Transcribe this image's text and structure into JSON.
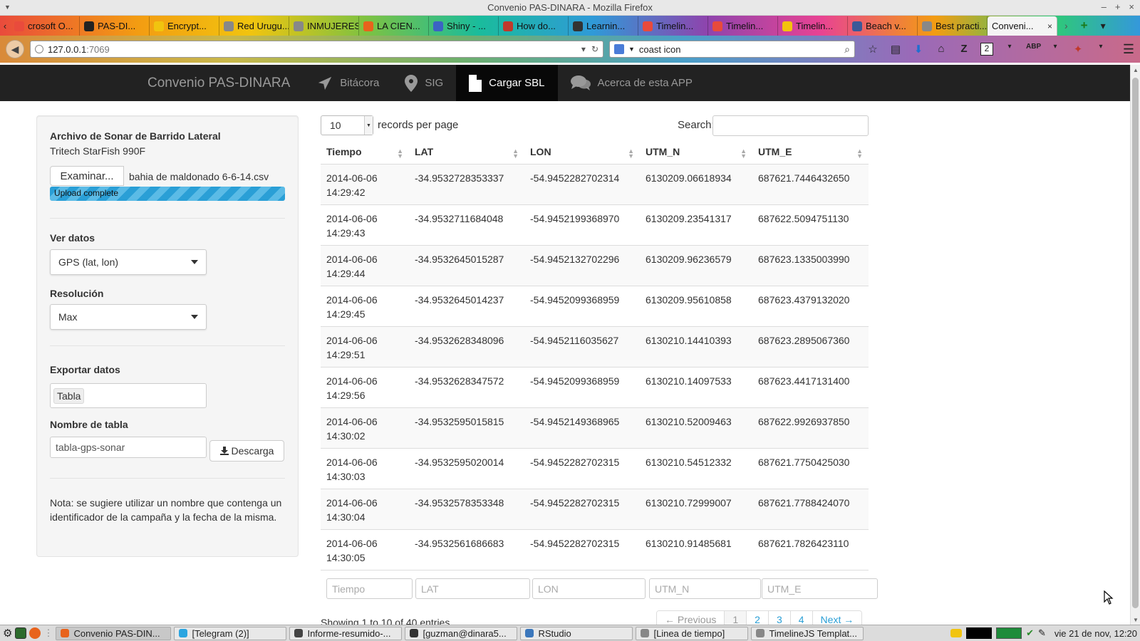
{
  "window": {
    "title": "Convenio PAS-DINARA - Mozilla Firefox"
  },
  "tabs": [
    {
      "label": "crosoft O...",
      "color": "#e94b3c"
    },
    {
      "label": "PAS-DI...",
      "color": "#222222"
    },
    {
      "label": "Encrypt...",
      "color": "#f1c40f"
    },
    {
      "label": "Red Urugu...",
      "color": "#888888"
    },
    {
      "label": "INMUJERES...",
      "color": "#888888"
    },
    {
      "label": "LA CIEN...",
      "color": "#e8631c"
    },
    {
      "label": "Shiny - ...",
      "color": "#3b63c4"
    },
    {
      "label": "How do...",
      "color": "#c0392b"
    },
    {
      "label": "Learnin...",
      "color": "#333333"
    },
    {
      "label": "Timelin...",
      "color": "#e84a3c"
    },
    {
      "label": "Timelin...",
      "color": "#e84a3c"
    },
    {
      "label": "Timelin...",
      "color": "#f4c20d"
    },
    {
      "label": "Beach v...",
      "color": "#3b5998"
    },
    {
      "label": "Best practi...",
      "color": "#888888"
    }
  ],
  "active_tab": {
    "label": "Conveni...",
    "close": "×"
  },
  "address": {
    "host": "127.0.0.1",
    "port": ":7069"
  },
  "search": {
    "query": "coast icon"
  },
  "toolbar_badge": "2",
  "app": {
    "brand": "Convenio PAS-DINARA",
    "nav": [
      {
        "label": "Bitácora",
        "icon": "paper-plane-icon"
      },
      {
        "label": "SIG",
        "icon": "map-marker-icon"
      },
      {
        "label": "Cargar SBL",
        "icon": "file-icon",
        "active": true
      },
      {
        "label": "Acerca de esta APP",
        "icon": "comments-icon"
      }
    ]
  },
  "sidebar": {
    "file_title": "Archivo de Sonar de Barrido Lateral",
    "file_subtitle": "Tritech StarFish 990F",
    "browse_button": "Examinar...",
    "file_name": "bahia de maldonado 6-6-14.csv",
    "upload_status": "Upload complete",
    "upload_progress_percent": 100,
    "ver_datos_label": "Ver datos",
    "ver_datos_value": "GPS (lat, lon)",
    "resolucion_label": "Resolución",
    "resolucion_value": "Max",
    "exportar_label": "Exportar datos",
    "exportar_value": "Tabla",
    "nombre_label": "Nombre de tabla",
    "nombre_value": "tabla-gps-sonar",
    "download_button": "Descarga",
    "note": "Nota: se sugiere utilizar un nombre que contenga un identificador de la campaña y la fecha de la misma."
  },
  "table": {
    "length_value": "10",
    "length_label": "records per page",
    "search_label": "Search:",
    "columns": [
      "Tiempo",
      "LAT",
      "LON",
      "UTM_N",
      "UTM_E"
    ],
    "rows": [
      [
        "2014-06-06 14:29:42",
        "-34.9532728353337",
        "-54.9452282702314",
        "6130209.06618934",
        "687621.7446432650"
      ],
      [
        "2014-06-06 14:29:43",
        "-34.9532711684048",
        "-54.9452199368970",
        "6130209.23541317",
        "687622.5094751130"
      ],
      [
        "2014-06-06 14:29:44",
        "-34.9532645015287",
        "-54.9452132702296",
        "6130209.96236579",
        "687623.1335003990"
      ],
      [
        "2014-06-06 14:29:45",
        "-34.9532645014237",
        "-54.9452099368959",
        "6130209.95610858",
        "687623.4379132020"
      ],
      [
        "2014-06-06 14:29:51",
        "-34.9532628348096",
        "-54.9452116035627",
        "6130210.14410393",
        "687623.2895067360"
      ],
      [
        "2014-06-06 14:29:56",
        "-34.9532628347572",
        "-54.9452099368959",
        "6130210.14097533",
        "687623.4417131400"
      ],
      [
        "2014-06-06 14:30:02",
        "-34.9532595015815",
        "-54.9452149368965",
        "6130210.52009463",
        "687622.9926937850"
      ],
      [
        "2014-06-06 14:30:03",
        "-34.9532595020014",
        "-54.9452282702315",
        "6130210.54512332",
        "687621.7750425030"
      ],
      [
        "2014-06-06 14:30:04",
        "-34.9532578353348",
        "-54.9452282702315",
        "6130210.72999007",
        "687621.7788424070"
      ],
      [
        "2014-06-06 14:30:05",
        "-34.9532561686683",
        "-54.9452282702315",
        "6130210.91485681",
        "687621.7826423110"
      ]
    ],
    "filter_placeholders": [
      "Tiempo",
      "LAT",
      "LON",
      "UTM_N",
      "UTM_E"
    ],
    "info": "Showing 1 to 10 of 40 entries",
    "pager": {
      "previous": "← Previous",
      "pages": [
        "1",
        "2",
        "3",
        "4"
      ],
      "current": "1",
      "next": "Next →"
    }
  },
  "taskbar": {
    "tasks": [
      {
        "label": "Convenio PAS-DIN...",
        "color": "#e8631c",
        "active": true
      },
      {
        "label": "[Telegram (2)]",
        "color": "#2ca5e0"
      },
      {
        "label": "Informe-resumido-...",
        "color": "#444444"
      },
      {
        "label": "[guzman@dinara5...",
        "color": "#333333"
      },
      {
        "label": "RStudio",
        "color": "#3b77bc"
      },
      {
        "label": "[Linea de tiempo]",
        "color": "#888888"
      },
      {
        "label": "TimelineJS Templat...",
        "color": "#888888"
      }
    ],
    "clock": "vie 21 de nov, 12:20"
  }
}
